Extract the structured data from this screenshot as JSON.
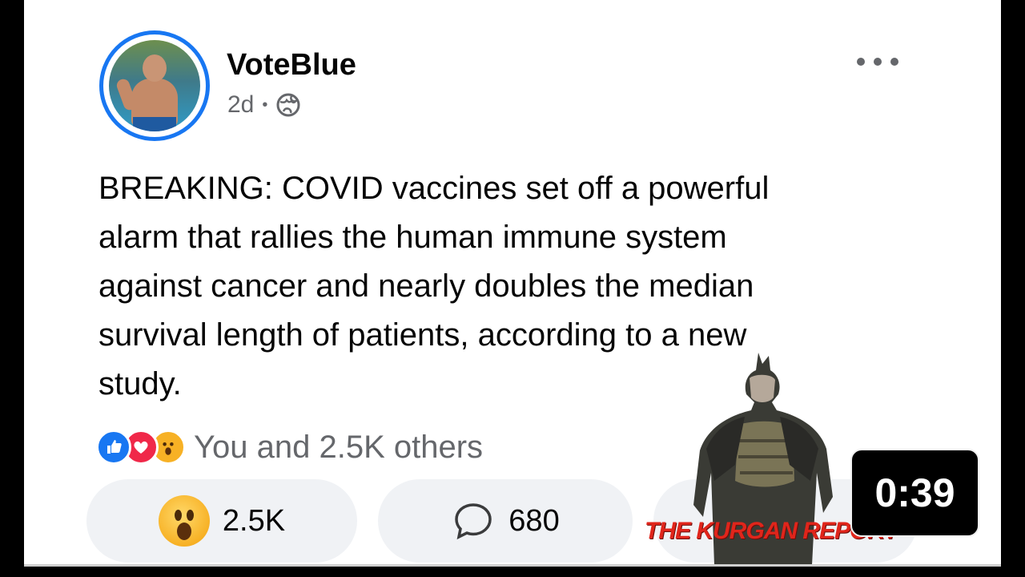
{
  "post": {
    "author": "VoteBlue",
    "time": "2d",
    "separator": "•",
    "text_lines": [
      "BREAKING: COVID vaccines set off a powerful",
      "alarm that rallies the human immune system",
      "against cancer and nearly doubles the median",
      "survival length of patients, according to a new",
      "study."
    ],
    "reactions_summary": "You and 2.5K others",
    "reaction_icons": [
      "like-icon",
      "love-icon",
      "wow-icon"
    ]
  },
  "actions": {
    "reaction_count": "2.5K",
    "comment_count": "680"
  },
  "overlay": {
    "brand": "THE KURGAN REPORT",
    "duration": "0:39"
  },
  "colors": {
    "accent": "#1877f2",
    "love": "#f02849",
    "wow": "#f7b125",
    "brand_red": "#e0251b"
  }
}
